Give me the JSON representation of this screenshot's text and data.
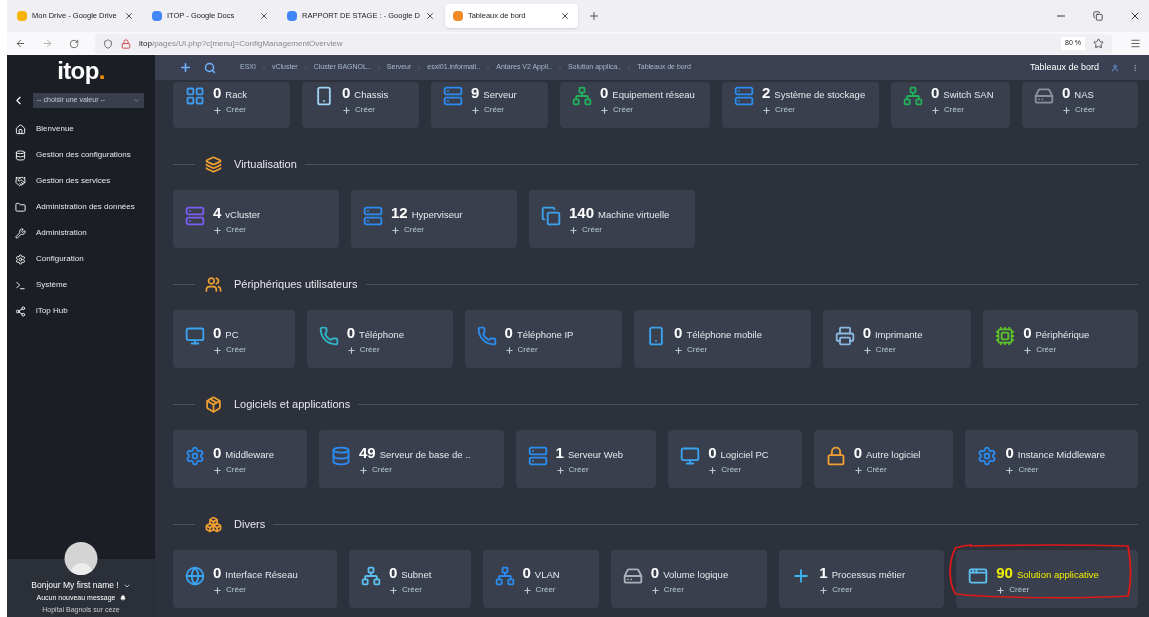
{
  "browser": {
    "tabs": [
      {
        "title": "Mon Drive - Google Drive",
        "selected": false
      },
      {
        "title": "ITOP - Google Docs",
        "selected": false
      },
      {
        "title": "RAPPORT DE STAGE : - Google D",
        "selected": false
      },
      {
        "title": "Tableaux de bord",
        "selected": true
      }
    ],
    "url_host": "itop",
    "url_path": "/pages/UI.php?c[menu]=ConfigManagementOverview",
    "zoom": "80 %"
  },
  "sidebar": {
    "logo": "itop",
    "logo_mark": ".",
    "org_select": {
      "value": "-- choisir une valeur --"
    },
    "items": [
      {
        "label": "Bienvenue"
      },
      {
        "label": "Gestion des configurations"
      },
      {
        "label": "Gestion des services"
      },
      {
        "label": "Administration des données"
      },
      {
        "label": "Administration"
      },
      {
        "label": "Configuration"
      },
      {
        "label": "Système"
      },
      {
        "label": "iTop Hub"
      }
    ],
    "user": {
      "greeting": "Bonjour My first name !",
      "messages": "Aucun nouveau message",
      "organization": "Hopital Bagnols sur ceze"
    }
  },
  "top_bar": {
    "breadcrumbs": [
      "ESXI",
      "vCluster",
      "Cluster BAGNOL..",
      "Serveur",
      "esxi01.informati..",
      "Antares V2 Appli..",
      "Solution applica..",
      "Tableaux de bord"
    ],
    "page_title": "Tableaux de bord"
  },
  "sections": [
    {
      "tiles": [
        {
          "count": "0",
          "label": "Rack",
          "action": "Créer",
          "highlighted": false
        },
        {
          "count": "0",
          "label": "Chassis",
          "action": "Créer",
          "highlighted": false
        },
        {
          "count": "9",
          "label": "Serveur",
          "action": "Créer",
          "highlighted": false
        },
        {
          "count": "0",
          "label": "Equipement réseau",
          "action": "Créer",
          "highlighted": false
        },
        {
          "count": "2",
          "label": "Système de stockage",
          "action": "Créer",
          "highlighted": false
        },
        {
          "count": "0",
          "label": "Switch SAN",
          "action": "Créer",
          "highlighted": false
        },
        {
          "count": "0",
          "label": "NAS",
          "action": "Créer",
          "highlighted": false
        }
      ]
    },
    {
      "title": "Virtualisation",
      "tiles": [
        {
          "count": "4",
          "label": "vCluster",
          "action": "Créer",
          "highlighted": false
        },
        {
          "count": "12",
          "label": "Hyperviseur",
          "action": "Créer",
          "highlighted": false
        },
        {
          "count": "140",
          "label": "Machine virtuelle",
          "action": "Créer",
          "highlighted": false
        }
      ]
    },
    {
      "title": "Périphériques utilisateurs",
      "tiles": [
        {
          "count": "0",
          "label": "PC",
          "action": "Créer",
          "highlighted": false
        },
        {
          "count": "0",
          "label": "Téléphone",
          "action": "Créer",
          "highlighted": false
        },
        {
          "count": "0",
          "label": "Téléphone IP",
          "action": "Créer",
          "highlighted": false
        },
        {
          "count": "0",
          "label": "Téléphone mobile",
          "action": "Créer",
          "highlighted": false
        },
        {
          "count": "0",
          "label": "Imprimante",
          "action": "Créer",
          "highlighted": false
        },
        {
          "count": "0",
          "label": "Périphérique",
          "action": "Créer",
          "highlighted": false
        }
      ]
    },
    {
      "title": "Logiciels et applications",
      "tiles": [
        {
          "count": "0",
          "label": "Middleware",
          "action": "Créer",
          "highlighted": false
        },
        {
          "count": "49",
          "label": "Serveur de base de ..",
          "action": "Créer",
          "highlighted": false
        },
        {
          "count": "1",
          "label": "Serveur Web",
          "action": "Créer",
          "highlighted": false
        },
        {
          "count": "0",
          "label": "Logiciel PC",
          "action": "Créer",
          "highlighted": false
        },
        {
          "count": "0",
          "label": "Autre logiciel",
          "action": "Créer",
          "highlighted": false
        },
        {
          "count": "0",
          "label": "Instance Middleware",
          "action": "Créer",
          "highlighted": false
        }
      ]
    },
    {
      "title": "Divers",
      "tiles": [
        {
          "count": "0",
          "label": "Interface Réseau",
          "action": "Créer",
          "highlighted": false
        },
        {
          "count": "0",
          "label": "Subnet",
          "action": "Créer",
          "highlighted": false
        },
        {
          "count": "0",
          "label": "VLAN",
          "action": "Créer",
          "highlighted": false
        },
        {
          "count": "0",
          "label": "Volume logique",
          "action": "Créer",
          "highlighted": false
        },
        {
          "count": "1",
          "label": "Processus métier",
          "action": "Créer",
          "highlighted": false
        },
        {
          "count": "90",
          "label": "Solution applicative",
          "action": "Créer",
          "highlighted": true
        }
      ]
    }
  ]
}
